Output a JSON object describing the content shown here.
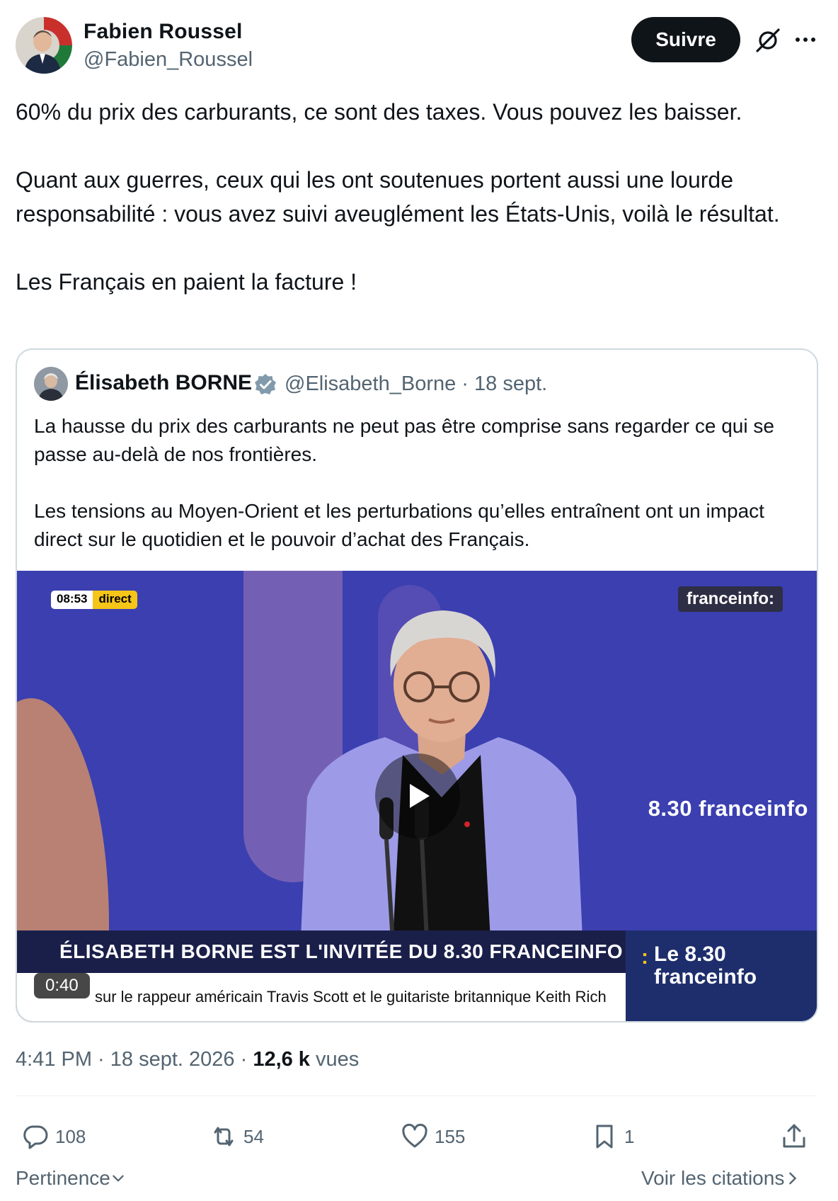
{
  "author": {
    "name": "Fabien Roussel",
    "handle": "@Fabien_Roussel"
  },
  "follow_label": "Suivre",
  "tweet": {
    "paragraphs": [
      "60% du prix des carburants, ce sont des taxes. Vous pouvez les baisser.",
      "Quant aux guerres, ceux qui les ont soutenues portent aussi une lourde responsabilité : vous avez suivi aveuglément les États-Unis, voilà le résultat.",
      "Les Français en paient la facture !"
    ]
  },
  "quote": {
    "name": "Élisabeth BORNE",
    "handle_date": "@Elisabeth_Borne · 18 sept.",
    "paragraphs": [
      "La hausse du prix des carburants ne peut pas être comprise sans regarder ce qui se passe au-delà de nos frontières.",
      "Les tensions au Moyen-Orient et les perturbations qu’elles entraînent ont un impact direct sur le quotidien et le pouvoir d’achat des Français."
    ],
    "video": {
      "live_time": "08:53",
      "live_label": "direct",
      "channel_logo": "franceinfo:",
      "show_name": "8.30 franceinfo",
      "banner": "ÉLISABETH BORNE EST L'INVITÉE DU 8.30 FRANCEINFO",
      "ticker": "sur le rappeur américain Travis Scott et le guitariste britannique Keith Rich",
      "side_line1": "Le 8.30",
      "side_line2": "franceinfo",
      "duration": "0:40"
    }
  },
  "meta": {
    "time_date": "4:41 PM · 18 sept. 2026 · ",
    "views_count": "12,6 k",
    "views_label": " vues"
  },
  "actions": {
    "replies": "108",
    "retweets": "54",
    "likes": "155",
    "bookmarks": "1"
  },
  "footer": {
    "sort_label": "Pertinence",
    "quotes_label": "Voir les citations"
  },
  "colors": {
    "text": "#0f1419",
    "secondary": "#536471",
    "verified": "#829aab",
    "video_bg": "#3b3fb0"
  }
}
